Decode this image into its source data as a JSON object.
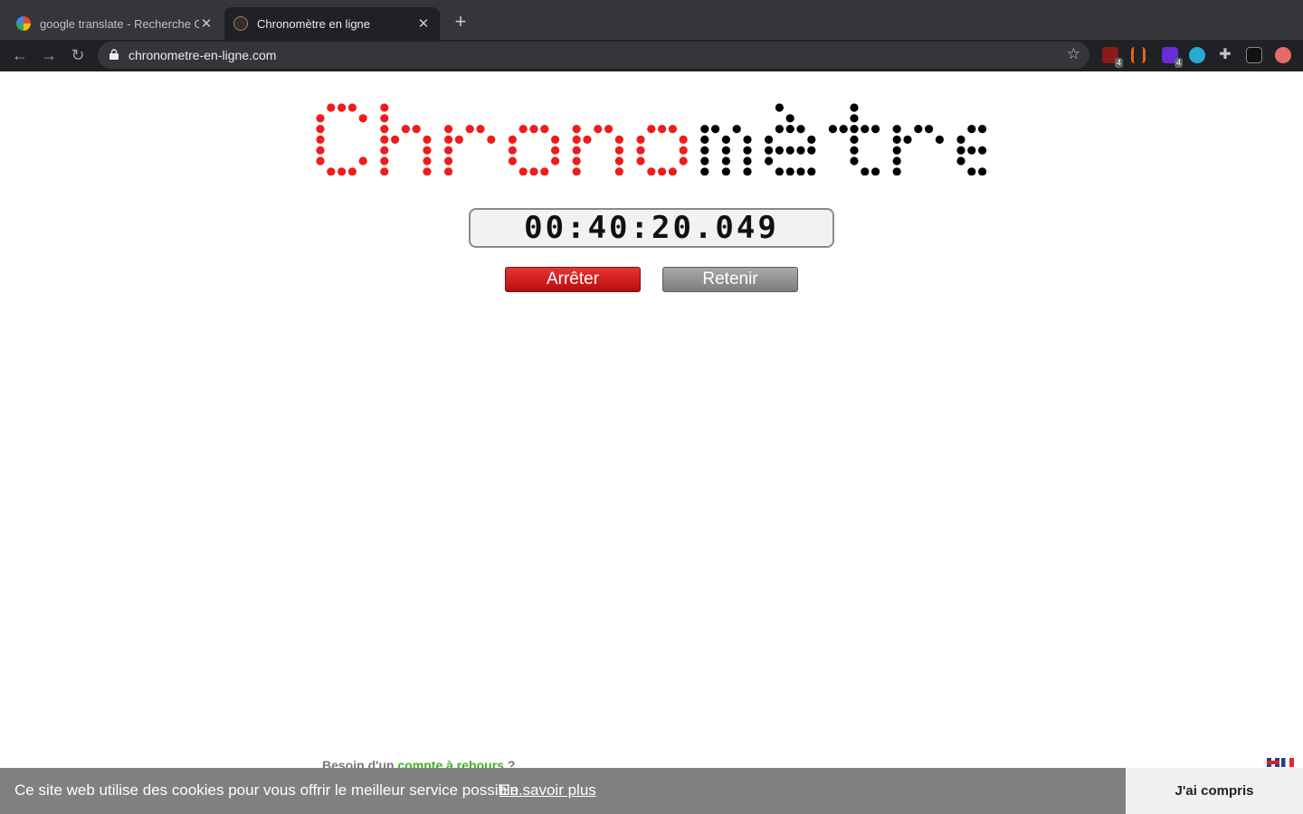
{
  "browser": {
    "tabs": [
      {
        "label": "google translate - Recherche G",
        "active": false
      },
      {
        "label": "Chronomètre en ligne",
        "active": true
      }
    ],
    "new_tab": "+",
    "url": "chronometre-en-ligne.com",
    "extensions": [
      "ublock-origin",
      "analytics-ext",
      "purple-ext",
      "blue-ext",
      "puzzle-icon",
      "shield-ext",
      "profile-ext"
    ],
    "extension_badges": {
      "ublock": "4",
      "purple": "4"
    }
  },
  "page": {
    "logo_text": "Chronomètre",
    "logo_colors": {
      "first": "#ee1c1c",
      "second": "#000000"
    },
    "timer": "00:40:20.049",
    "buttons": {
      "stop": "Arrêter",
      "lap": "Retenir"
    },
    "footer": {
      "prefix": "Besoin d'un",
      "link": "compte à rebours",
      "suffix": "?"
    }
  },
  "cookie_banner": {
    "message": "Ce site web utilise des cookies pour vous offrir le meilleur service possible.",
    "learn_more": "En savoir plus",
    "accept": "J'ai compris"
  }
}
